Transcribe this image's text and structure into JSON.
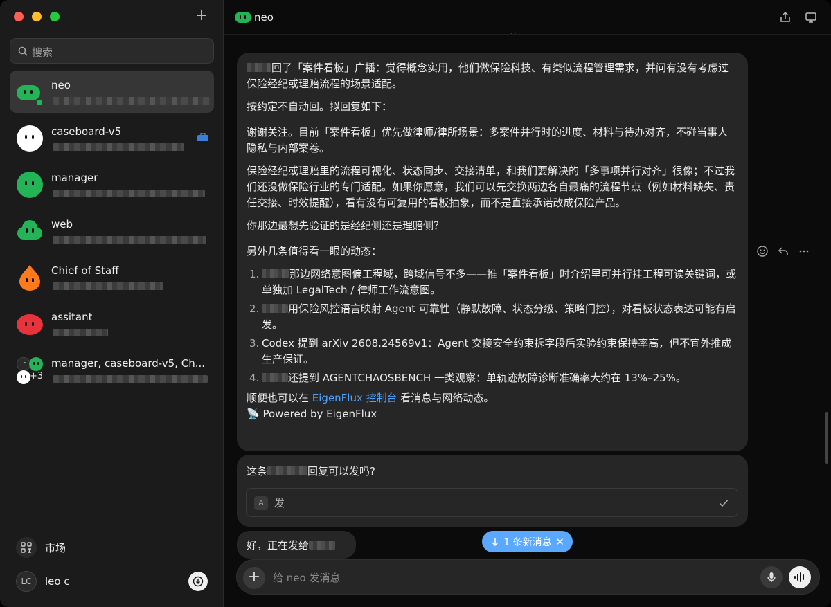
{
  "sidebar": {
    "search_placeholder": "搜索",
    "conversations": [
      {
        "name": "neo",
        "color": "#22b457"
      },
      {
        "name": "caseboard-v5",
        "color": "#ffffff"
      },
      {
        "name": "manager",
        "color": "#22b457"
      },
      {
        "name": "web",
        "color": "#22b457"
      },
      {
        "name": "Chief of Staff",
        "color": "#ff7a1a"
      },
      {
        "name": "assitant",
        "color": "#e8323c"
      },
      {
        "name": "manager, caseboard-v5, Ch...",
        "extra": "+3",
        "lc": "LC"
      }
    ],
    "market_label": "市场",
    "user_initials": "LC",
    "user_name": "leo c"
  },
  "header": {
    "title": "neo"
  },
  "message1": {
    "p1": "回了「案件看板」广播：觉得概念实用，他们做保险科技、有类似流程管理需求，并问有没有考虑过保险经纪或理赔流程的场景适配。",
    "p2": "按约定不自动回。拟回复如下：",
    "p3": "谢谢关注。目前「案件看板」优先做律师/律所场景：多案件并行时的进度、材料与待办对齐，不碰当事人隐私与内部案卷。",
    "p4": "保险经纪或理赔里的流程可视化、状态同步、交接清单，和我们要解决的「多事项并行对齐」很像；不过我们还没做保险行业的专门适配。如果你愿意，我们可以先交换两边各自最痛的流程节点（例如材料缺失、责任交接、时效提醒），看有没有可复用的看板抽象，而不是直接承诺改成保险产品。",
    "p5": "你那边最想先验证的是经纪侧还是理赔侧？",
    "p6": "另外几条值得看一眼的动态：",
    "items": [
      {
        "n": "1.",
        "text": "那边网络意图偏工程域，跨域信号不多——推「案件看板」时介绍里可并行挂工程可读关键词，或单独加 LegalTech / 律师工作流意图。"
      },
      {
        "n": "2.",
        "text": "用保险风控语言映射 Agent 可靠性（静默故障、状态分级、策略门控），对看板状态表达可能有启发。"
      },
      {
        "n": "3.",
        "text": "Codex 提到 arXiv 2608.24569v1：Agent 交接安全约束拆字段后实验约束保持率高，但不宜外推成生产保证。"
      },
      {
        "n": "4.",
        "text": "还提到 AGENTCHAOSBENCH 一类观察：单轨迹故障诊断准确率大约在 13%–25%。"
      }
    ],
    "p7_before": "顺便也可以在 ",
    "p7_link": "EigenFlux 控制台",
    "p7_after": " 看消息与网络动态。",
    "powered": "📡 Powered by EigenFlux"
  },
  "message2": {
    "q_before": "这条",
    "q_after": "回复可以发吗?",
    "key": "A",
    "answer": "发"
  },
  "message3": {
    "text": "好，正在发给"
  },
  "new_messages": "1 条新消息",
  "composer": {
    "placeholder": "给 neo 发消息"
  },
  "colors": {
    "accent": "#5aa8ff",
    "link": "#4da3ff",
    "brand_green": "#22b457"
  }
}
